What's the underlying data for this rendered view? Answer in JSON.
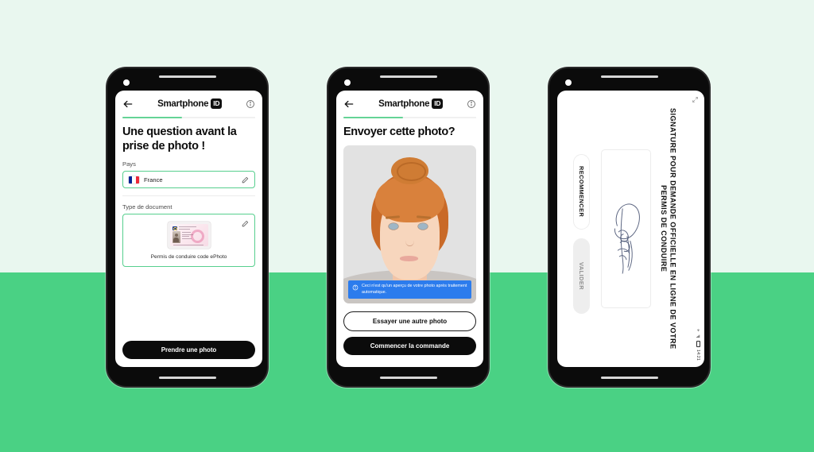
{
  "background": {
    "top_color": "#e9f7ef",
    "bottom_color": "#4ad184"
  },
  "brand": {
    "word": "Smartphone",
    "badge": "ID"
  },
  "phone1": {
    "header": {
      "back_icon": "arrow-left-icon",
      "info_icon": "info-circle-icon",
      "progress_percent": 45
    },
    "title": "Une question avant la prise de photo !",
    "country_field": {
      "label": "Pays",
      "value": "France",
      "flag": "flag-france-icon",
      "edit_icon": "pencil-icon"
    },
    "document_field": {
      "label": "Type de document",
      "value": "Permis de conduire code ePhoto",
      "thumbnail": "driving-license-thumbnail",
      "edit_icon": "pencil-icon"
    },
    "primary_button": "Prendre une photo"
  },
  "phone2": {
    "header": {
      "back_icon": "arrow-left-icon",
      "info_icon": "info-circle-icon",
      "progress_percent": 45
    },
    "title": "Envoyer cette photo?",
    "photo": "portrait-preview",
    "banner": {
      "icon": "info-circle-icon",
      "text": "Ceci n'est qu'un aperçu de votre photo après traitement automatique."
    },
    "secondary_button": "Essayer une autre photo",
    "primary_button": "Commencer la commande"
  },
  "phone3": {
    "headline": "SIGNATURE POUR DEMANDE OFFICIELLE EN LIGNE DE VOTRE PERMIS DE CONDUIRE",
    "signature_pad": "signature-canvas",
    "restart_button": "RECOMMENCER",
    "validate_button": "VALIDER",
    "expand_icon": "expand-icon",
    "statusbar": {
      "time": "14:21",
      "icons": [
        "wifi-icon",
        "signal-icon",
        "battery-icon"
      ]
    }
  }
}
